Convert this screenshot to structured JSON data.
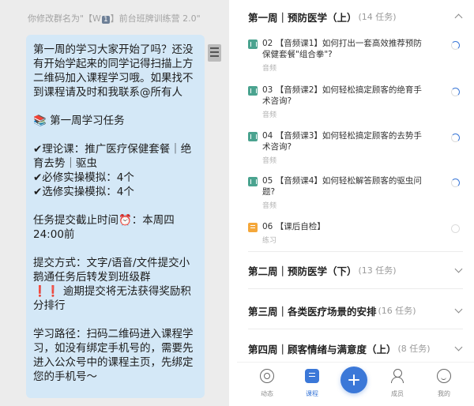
{
  "chat": {
    "hint_prefix": "你修改群名为\"【W",
    "hint_tag": "1",
    "hint_suffix": "】前台班牌训练营 2.0\"",
    "message": {
      "intro": "第一周的学习大家开始了吗？还没有开始学起来的同学记得扫描上方二维码加入课程学习哦。如果找不到课程请及时和我联系@所有人",
      "tasks_title": "📚 第一周学习任务",
      "theory": "✔理论课：推广医疗保健套餐｜绝育去势｜驱虫",
      "required": "✔必修实操模拟：4个",
      "elective": "✔选修实操模拟：4个",
      "deadline": "任务提交截止时间⏰：本周四24:00前",
      "submit_method": "提交方式：文字/语音/文件提交小鹅通任务后转发到班级群",
      "late_warning_mark": "❗❗",
      "late_warning": "逾期提交将无法获得奖励积分排行",
      "study_path": "学习路径：扫码二维码进入课程学习，如没有绑定手机号的，需要先进入公众号中的课程主页，先绑定您的手机号～"
    }
  },
  "course": {
    "weeks": [
      {
        "title": "第一周｜预防医学（上）",
        "count": "(14 任务)",
        "expanded": true
      },
      {
        "title": "第二周｜预防医学（下）",
        "count": "(13 任务)",
        "expanded": false
      },
      {
        "title": "第三周｜各类医疗场景的安排",
        "count": "(16 任务)",
        "expanded": false
      },
      {
        "title": "第四周｜顾客情绪与满意度（上）",
        "count": "(8 任务)",
        "expanded": false
      }
    ],
    "lessons": [
      {
        "title": "02 【音频课1】如何打出一套高效推荐预防保健套餐\"组合拳\"?",
        "type": "音频",
        "icon": "audio-icon",
        "progress": "partial"
      },
      {
        "title": "03 【音频课2】如何轻松搞定顾客的绝育手术咨询?",
        "type": "音频",
        "icon": "audio-icon",
        "progress": "partial"
      },
      {
        "title": "04 【音频课3】如何轻松搞定顾客的去势手术咨询?",
        "type": "音频",
        "icon": "audio-icon",
        "progress": "partial"
      },
      {
        "title": "05 【音频课4】如何轻松解答顾客的驱虫问题?",
        "type": "音频",
        "icon": "audio-icon",
        "progress": "partial"
      },
      {
        "title": "06 【课后自检】",
        "type": "练习",
        "icon": "exercise-icon",
        "progress": "none"
      }
    ]
  },
  "nav": {
    "feed": "动态",
    "course": "课程",
    "member": "成员",
    "me": "我的",
    "active": "course"
  },
  "colors": {
    "accent": "#3b78d8",
    "bubble": "#d4e8f7",
    "audio_icon": "#4aa38f",
    "exercise_icon": "#f4a73a",
    "warning": "#e22b2b"
  }
}
